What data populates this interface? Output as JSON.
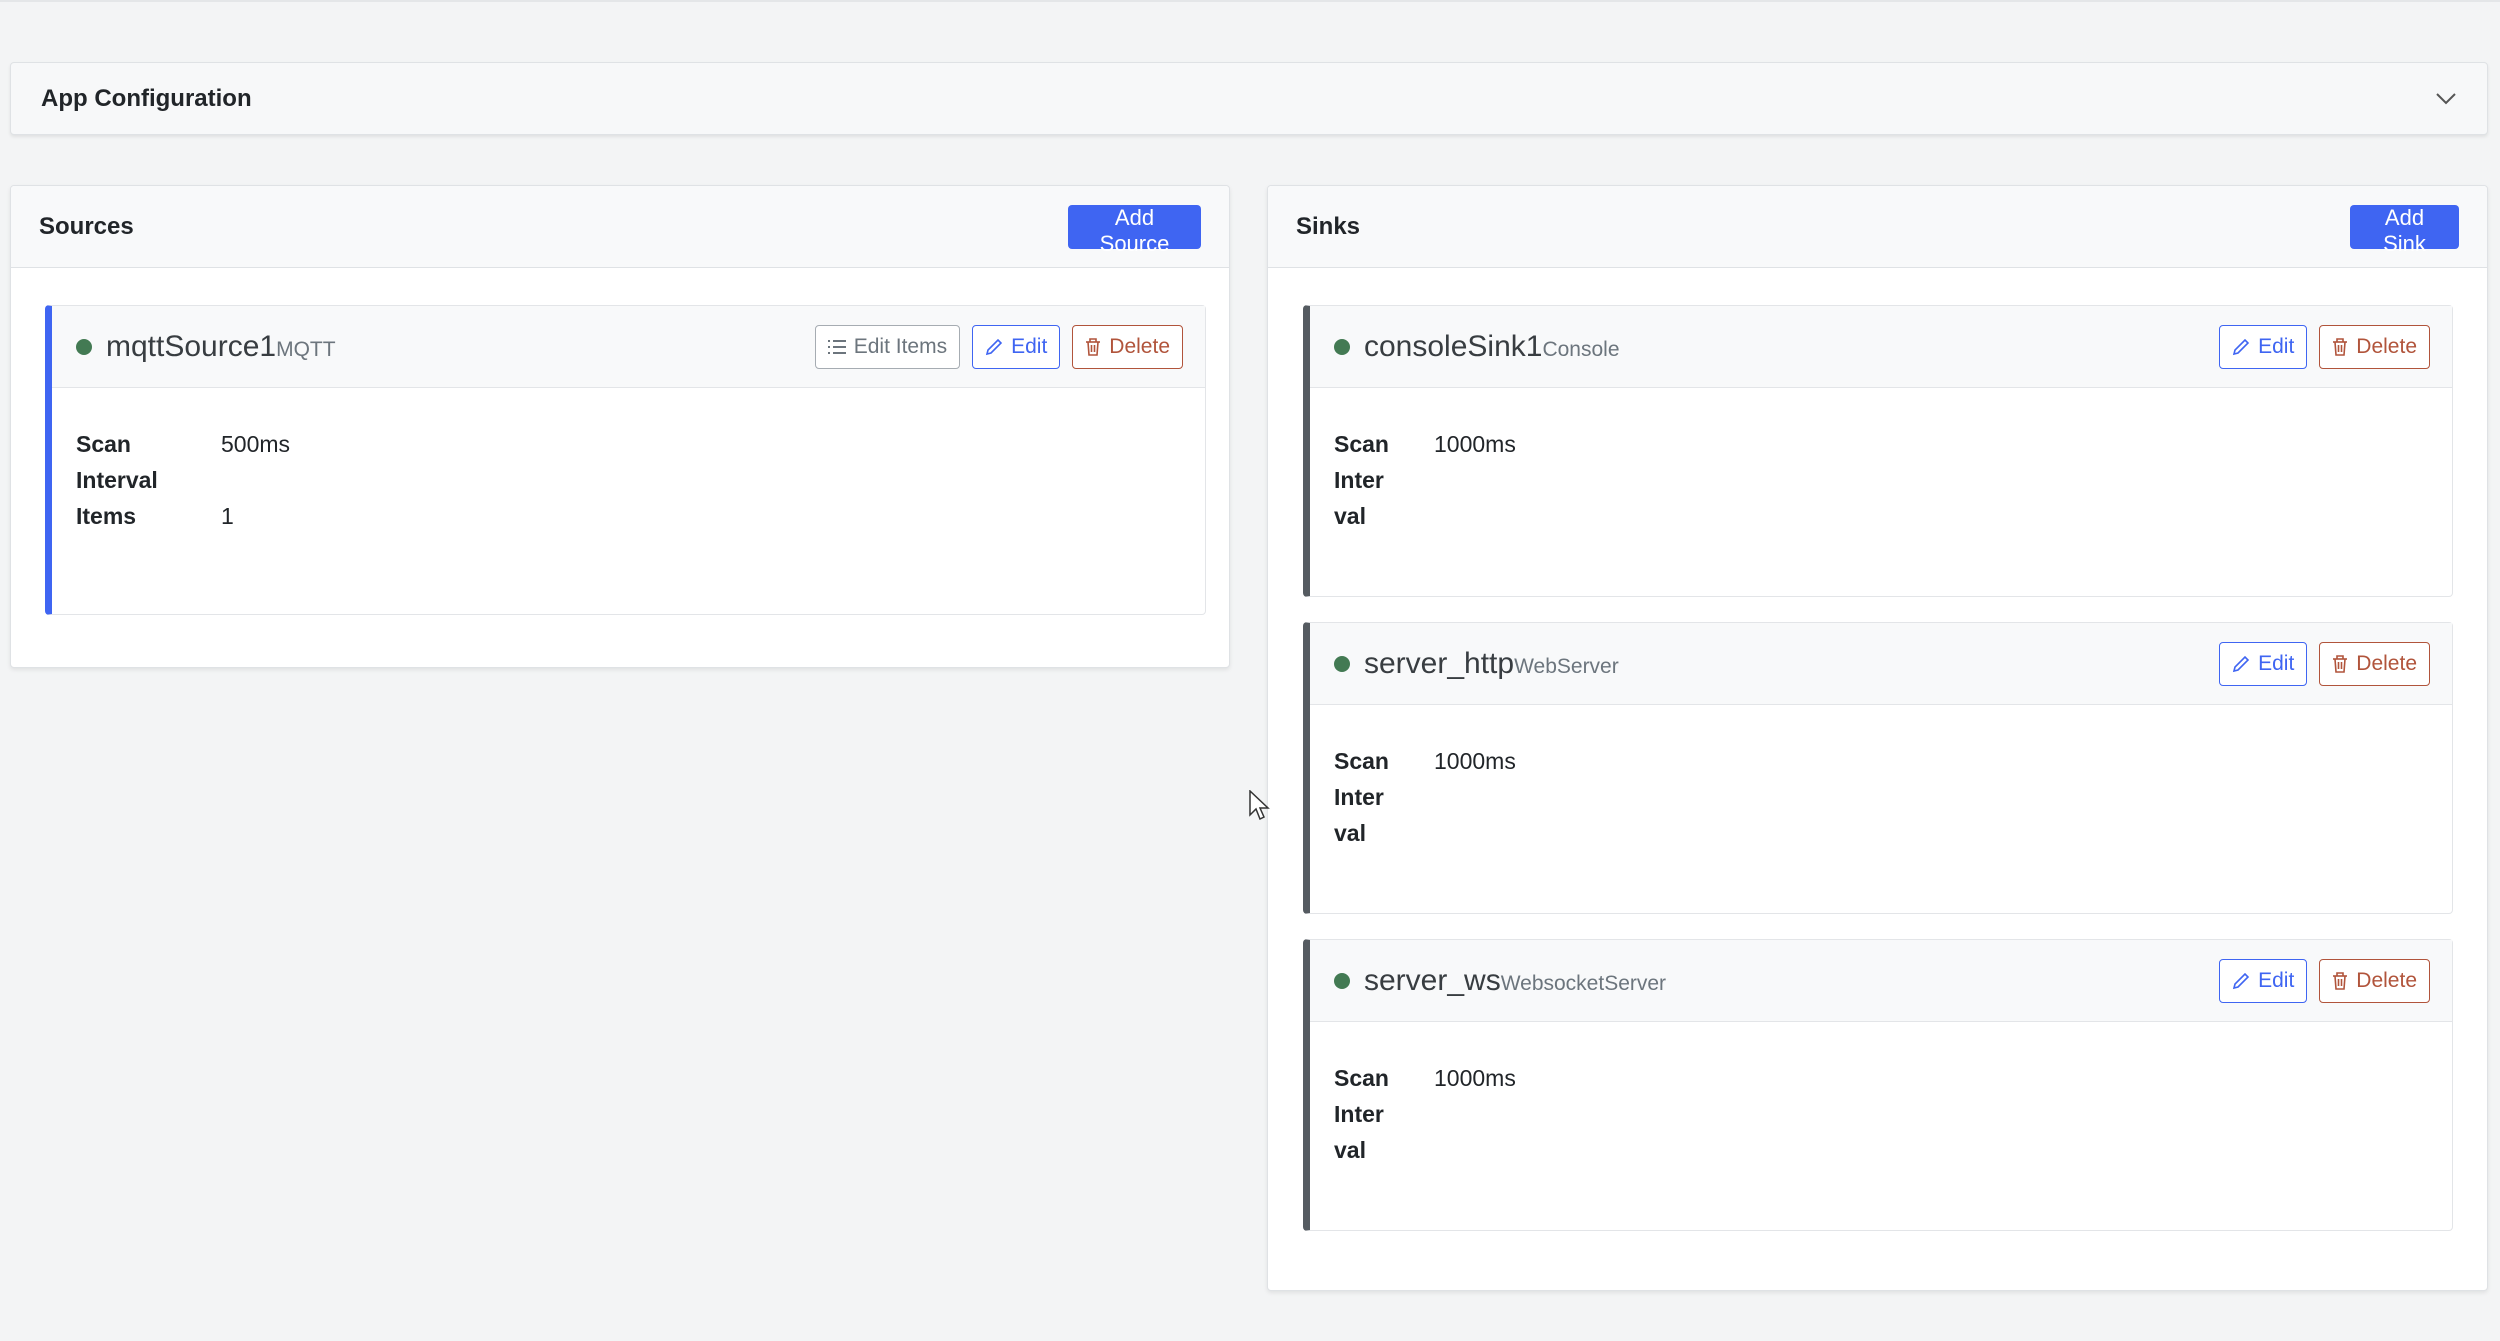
{
  "app_config": {
    "title": "App Configuration"
  },
  "sources": {
    "title": "Sources",
    "add_label": "Add Source",
    "items": [
      {
        "name": "mqttSource1",
        "type": "MQTT",
        "edit_items_label": "Edit Items",
        "edit_label": "Edit",
        "delete_label": "Delete",
        "scan_interval_label": "Scan\nInterval",
        "scan_interval_value": "500ms",
        "items_label": "Items",
        "items_value": "1"
      }
    ]
  },
  "sinks": {
    "title": "Sinks",
    "add_label": "Add Sink",
    "items": [
      {
        "name": "consoleSink1",
        "type": "Console",
        "edit_label": "Edit",
        "delete_label": "Delete",
        "scan_interval_label": "Scan\nInter\nval",
        "scan_interval_value": "1000ms"
      },
      {
        "name": "server_http",
        "type": "WebServer",
        "edit_label": "Edit",
        "delete_label": "Delete",
        "scan_interval_label": "Scan\nInter\nval",
        "scan_interval_value": "1000ms"
      },
      {
        "name": "server_ws",
        "type": "WebsocketServer",
        "edit_label": "Edit",
        "delete_label": "Delete",
        "scan_interval_label": "Scan\nInter\nval",
        "scan_interval_value": "1000ms"
      }
    ]
  },
  "colors": {
    "primary": "#3f65f2",
    "status_dot": "#437a53",
    "delete": "#b1543b",
    "source_accent": "#3f65f2",
    "sink_accent": "#555b61"
  },
  "icons": {
    "chevron": "chevron-down-icon",
    "list": "list-icon",
    "edit": "pencil-icon",
    "delete": "trash-icon"
  }
}
